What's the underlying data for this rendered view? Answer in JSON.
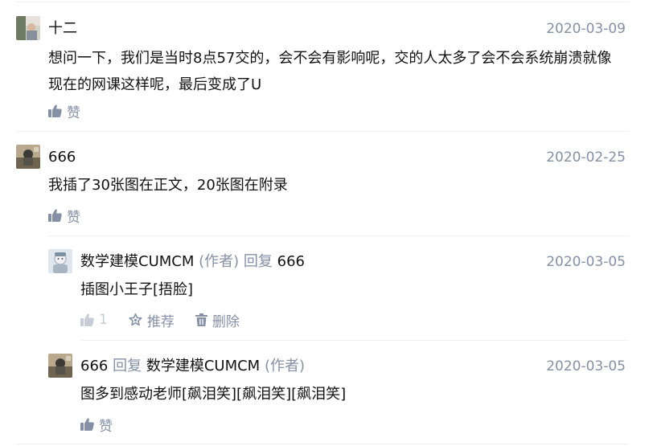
{
  "comments": [
    {
      "author": "十二",
      "date": "2020-03-09",
      "text": "想问一下，我们是当时8点57交的，会不会有影响呢，交的人太多了会不会系统崩溃就像现在的网课这样呢，最后变成了U",
      "like_label": "赞"
    },
    {
      "author": "666",
      "date": "2020-02-25",
      "text": "我插了30张图在正文，20张图在附录",
      "like_label": "赞"
    },
    {
      "author": "数学建模CUMCM",
      "author_tag": "(作者)",
      "reply_word": "回复",
      "reply_to": "666",
      "date": "2020-03-05",
      "text": "插图小王子[捂脸]",
      "like_count": "1",
      "recommend_label": "推荐",
      "delete_label": "删除"
    },
    {
      "author": "666",
      "reply_word": "回复",
      "reply_to": "数学建模CUMCM",
      "reply_to_tag": "(作者)",
      "date": "2020-03-05",
      "text": "图多到感动老师[飙泪笑][飙泪笑][飙泪笑]",
      "like_label": "赞"
    }
  ],
  "colors": {
    "text": "#121212",
    "muted": "#8590a6",
    "divider": "#f0f1f3"
  },
  "icons": {
    "like": "thumbs-up-icon",
    "recommend": "star-icon",
    "delete": "trash-icon"
  }
}
